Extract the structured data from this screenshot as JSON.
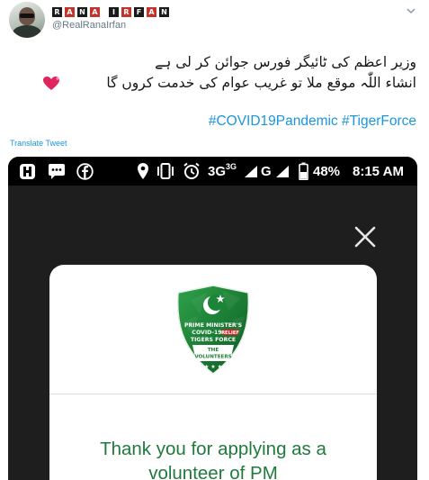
{
  "tweet": {
    "display_name_letters": [
      "R",
      "A",
      "N",
      "A",
      "",
      "I",
      "R",
      "F",
      "A",
      "N"
    ],
    "handle": "@RealRanaIrfan",
    "urdu_line_1": "وزیر اعظم کی ٹائیگر فورس جوائن کر لی ہے",
    "urdu_line_2": "انشاء اللّٰہ موقع ملا تو غریب عوام کی خدمت کروں گا",
    "heart_emoji": "heart-icon",
    "hashtags": "#COVID19Pandemic #TigerForce",
    "translate_label": "Translate Tweet",
    "colors": {
      "link": "#1b95e0",
      "text": "#14171a",
      "muted": "#657786"
    }
  },
  "phone": {
    "status": {
      "network": "3G",
      "network_sup": "3G",
      "network_g": "G",
      "battery": "48%",
      "time": "8:15 AM"
    },
    "badge": {
      "line1": "PRIME MINISTER'S",
      "line2_a": "COVID-19",
      "line2_b": "RELIEF",
      "line3": "TIGERS FORCE",
      "line4": "THE",
      "line5": "VOLUNTEERS"
    },
    "message_line_1": "Thank you for applying as a",
    "message_line_2": "volunteer of PM",
    "colors": {
      "dialog_text": "#1f7a3c",
      "badge_green": "#1e8a3a"
    }
  }
}
